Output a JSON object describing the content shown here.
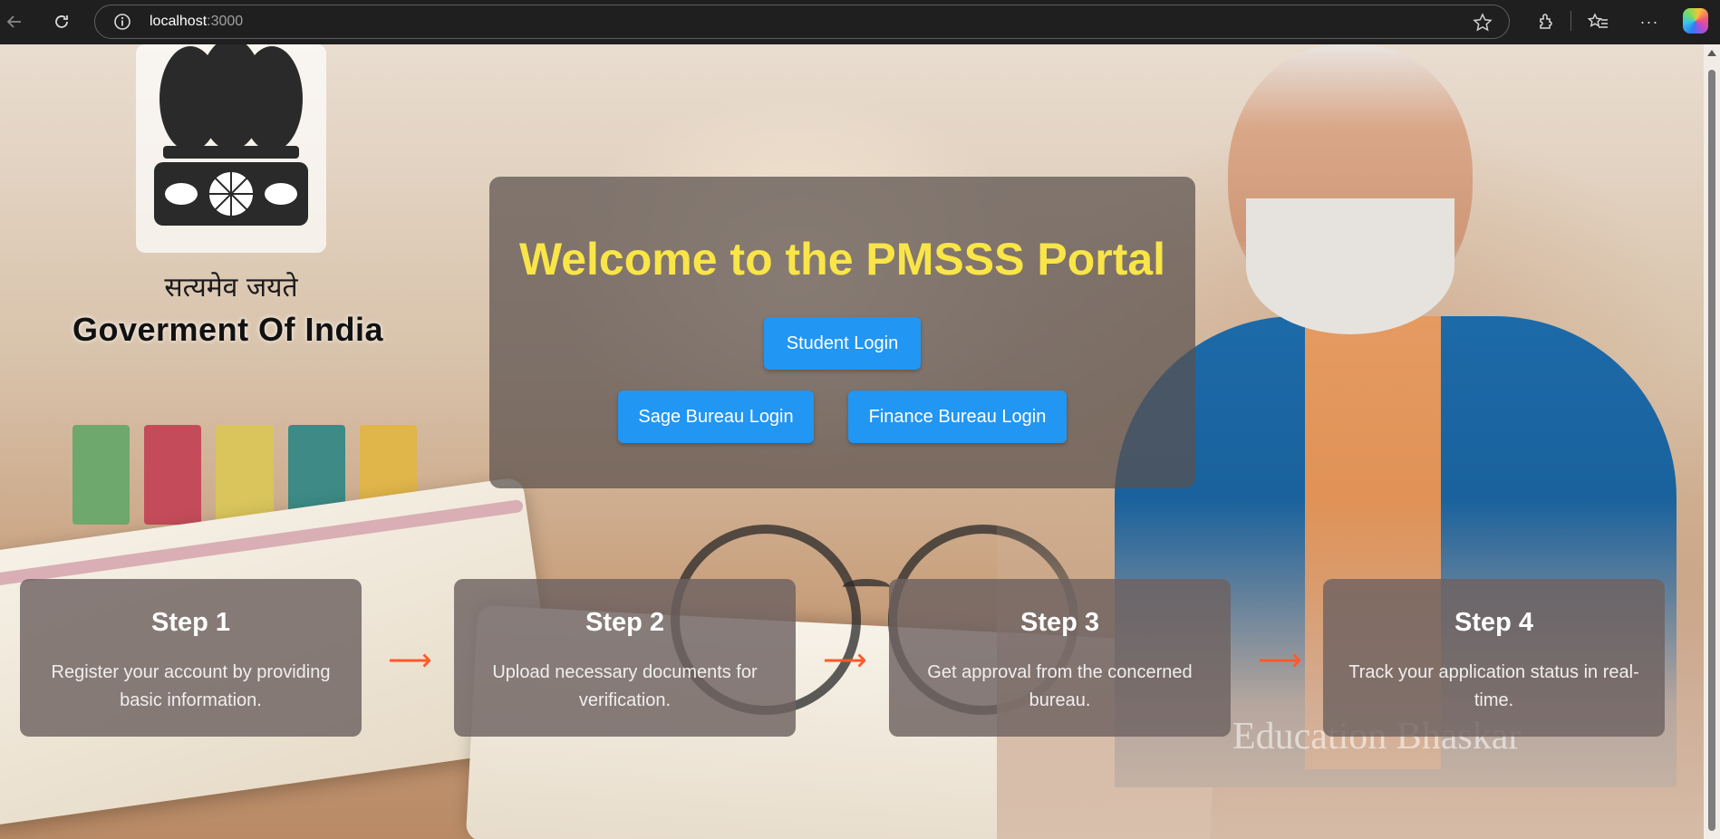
{
  "browser": {
    "url_host": "localhost",
    "url_port": ":3000",
    "icons": [
      "back-icon",
      "reload-icon",
      "info-icon",
      "star-icon",
      "extensions-icon",
      "favorites-icon",
      "more-icon",
      "copilot-icon"
    ]
  },
  "brand": {
    "motto": "सत्यमेव जयते",
    "government": "Goverment Of India"
  },
  "hero": {
    "title": "Welcome to the PMSSS Portal",
    "student_login": "Student Login",
    "sage_login": "Sage Bureau Login",
    "finance_login": "Finance Bureau Login"
  },
  "steps": [
    {
      "title": "Step 1",
      "desc": "Register your account by providing basic information."
    },
    {
      "title": "Step 2",
      "desc": "Upload necessary documents for verification."
    },
    {
      "title": "Step 3",
      "desc": "Get approval from the concerned bureau."
    },
    {
      "title": "Step 4",
      "desc": "Track your application status in real-time."
    }
  ],
  "step_arrow": "⟶",
  "watermark": "Education Bhaskar",
  "colors": {
    "title_yellow": "#f9e547",
    "button_blue": "#2196f3",
    "arrow_orange": "#ff5a2a"
  }
}
